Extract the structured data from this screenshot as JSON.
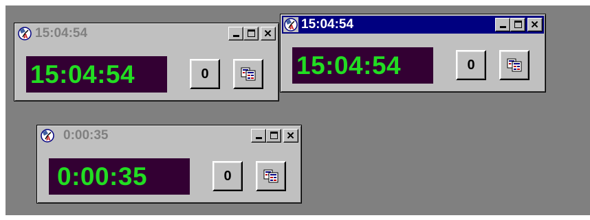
{
  "windows": [
    {
      "title": "15:04:54",
      "state": "inactive",
      "time_display": "15:04:54",
      "reset_label": "0",
      "buttons": {
        "minimize": "minimize",
        "maximize": "maximize",
        "close": "close",
        "copy": "copy"
      }
    },
    {
      "title": "15:04:54",
      "state": "active",
      "time_display": "15:04:54",
      "reset_label": "0",
      "buttons": {
        "minimize": "minimize",
        "maximize": "maximize",
        "close": "close",
        "copy": "copy"
      }
    },
    {
      "title": "0:00:35",
      "state": "inactive",
      "time_display": "0:00:35",
      "reset_label": "0",
      "buttons": {
        "minimize": "minimize",
        "maximize": "maximize",
        "close": "close",
        "copy": "copy"
      }
    }
  ],
  "colors": {
    "desktop": "#808080",
    "window_face": "#c0c0c0",
    "active_titlebar": "#000080",
    "inactive_title_text": "#808080",
    "display_background": "#330033",
    "display_digits": "#22dd22"
  },
  "icons": {
    "app": "clock-app-icon",
    "copy": "copy-to-clipboard-icon",
    "minimize": "minimize-icon",
    "maximize": "maximize-icon",
    "close": "close-icon"
  }
}
